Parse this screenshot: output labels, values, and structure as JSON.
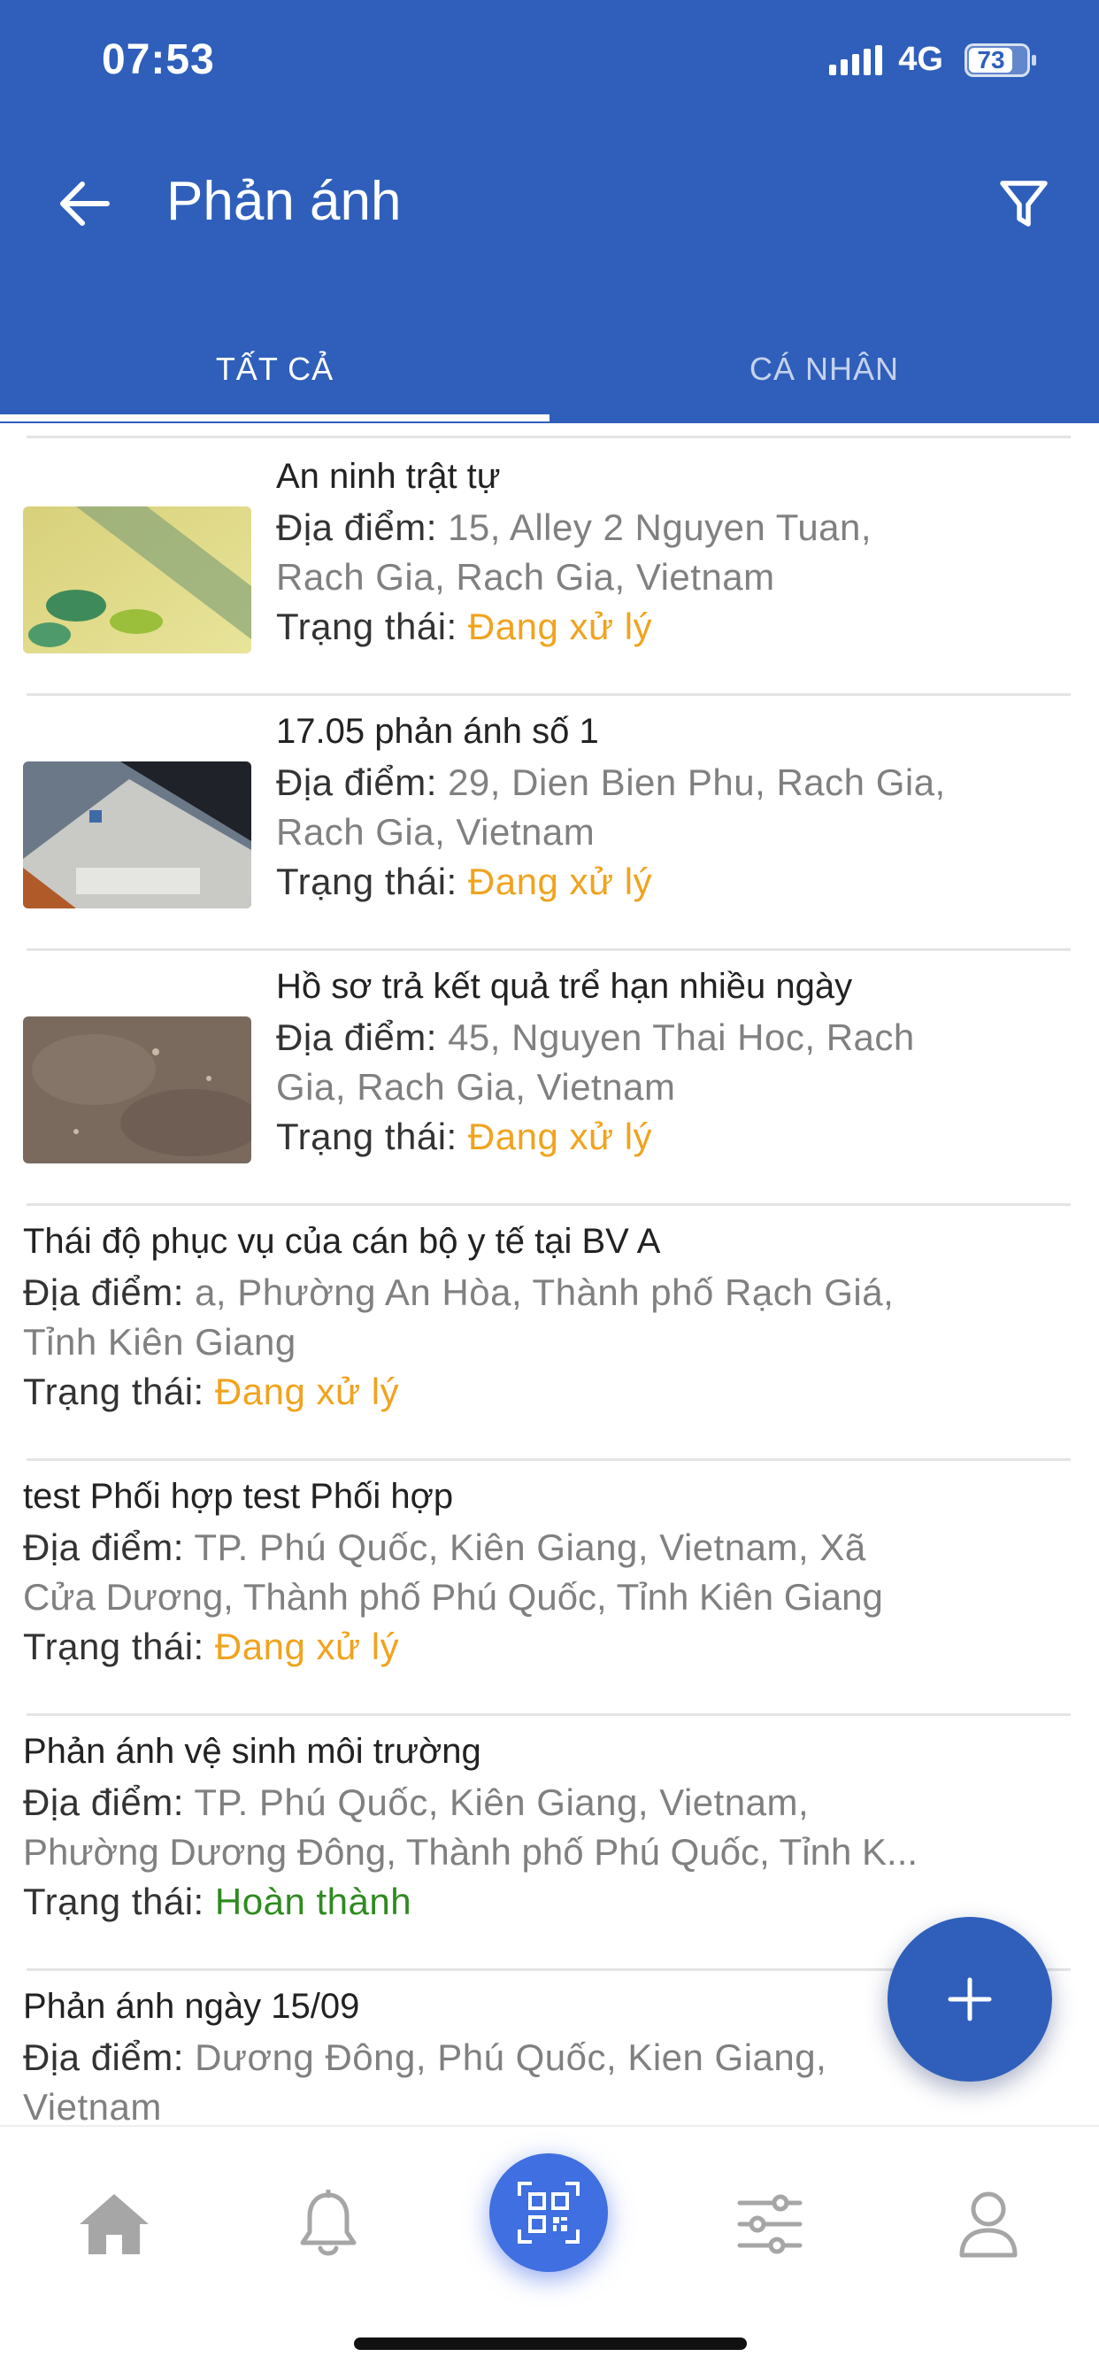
{
  "status_bar": {
    "time": "07:53",
    "network": "4G",
    "battery": "73"
  },
  "header": {
    "title": "Phản ánh"
  },
  "tabs": [
    {
      "label": "TẤT CẢ",
      "active": true
    },
    {
      "label": "CÁ NHÂN",
      "active": false
    }
  ],
  "labels": {
    "location": "Địa điểm:",
    "status": "Trạng thái:"
  },
  "items": [
    {
      "title": "An ninh trật tự",
      "location_lines": [
        "15, Alley 2 Nguyen Tuan,",
        "Rach Gia, Rach Gia, Vietnam"
      ],
      "status": "Đang xử lý",
      "status_color": "#f0a31e",
      "has_image": true
    },
    {
      "title": "17.05 phản ánh số 1",
      "location_lines": [
        "29, Dien Bien Phu, Rach Gia,",
        "Rach Gia, Vietnam"
      ],
      "status": "Đang xử lý",
      "status_color": "#f0a31e",
      "has_image": true
    },
    {
      "title": "Hồ sơ trả kết quả trể hạn nhiều ngày",
      "location_lines": [
        "45, Nguyen Thai Hoc, Rach",
        "Gia, Rach Gia, Vietnam"
      ],
      "status": "Đang xử lý",
      "status_color": "#f0a31e",
      "has_image": true
    },
    {
      "title": "Thái độ phục vụ của cán bộ y tế tại BV A",
      "location_lines": [
        "a, Phường An Hòa, Thành phố Rạch Giá,",
        "Tỉnh Kiên Giang"
      ],
      "status": "Đang xử lý",
      "status_color": "#f0a31e",
      "has_image": false
    },
    {
      "title": "test Phối hợp test Phối hợp",
      "location_lines": [
        "TP. Phú Quốc, Kiên Giang, Vietnam, Xã",
        "Cửa Dương, Thành phố Phú Quốc, Tỉnh Kiên Giang"
      ],
      "status": "Đang xử lý",
      "status_color": "#f0a31e",
      "has_image": false
    },
    {
      "title": "Phản ánh vệ sinh môi trường",
      "location_lines": [
        "TP. Phú Quốc, Kiên Giang, Vietnam,",
        "Phường Dương Đông, Thành phố Phú Quốc, Tỉnh K..."
      ],
      "status": "Hoàn thành",
      "status_color": "#2e8b1f",
      "has_image": false
    },
    {
      "title": "Phản ánh ngày 15/09",
      "location_lines": [
        "Dương Đông, Phú Quốc, Kien Giang,",
        "Vietnam"
      ],
      "status": "",
      "status_color": "#f0a31e",
      "has_image": false
    }
  ],
  "fab": {
    "icon": "plus-icon"
  },
  "bottom_nav": [
    {
      "icon": "home-icon",
      "active": false
    },
    {
      "icon": "bell-icon",
      "active": false
    },
    {
      "icon": "qr-scan-icon",
      "active": true
    },
    {
      "icon": "sliders-icon",
      "active": false
    },
    {
      "icon": "user-icon",
      "active": false
    }
  ],
  "colors": {
    "primary": "#2f5fbb",
    "pending": "#f0a31e",
    "done": "#2e8b1f",
    "muted_text": "#808080",
    "nav_icon": "#a6a6a6",
    "qr_button": "#3f6fe0"
  }
}
